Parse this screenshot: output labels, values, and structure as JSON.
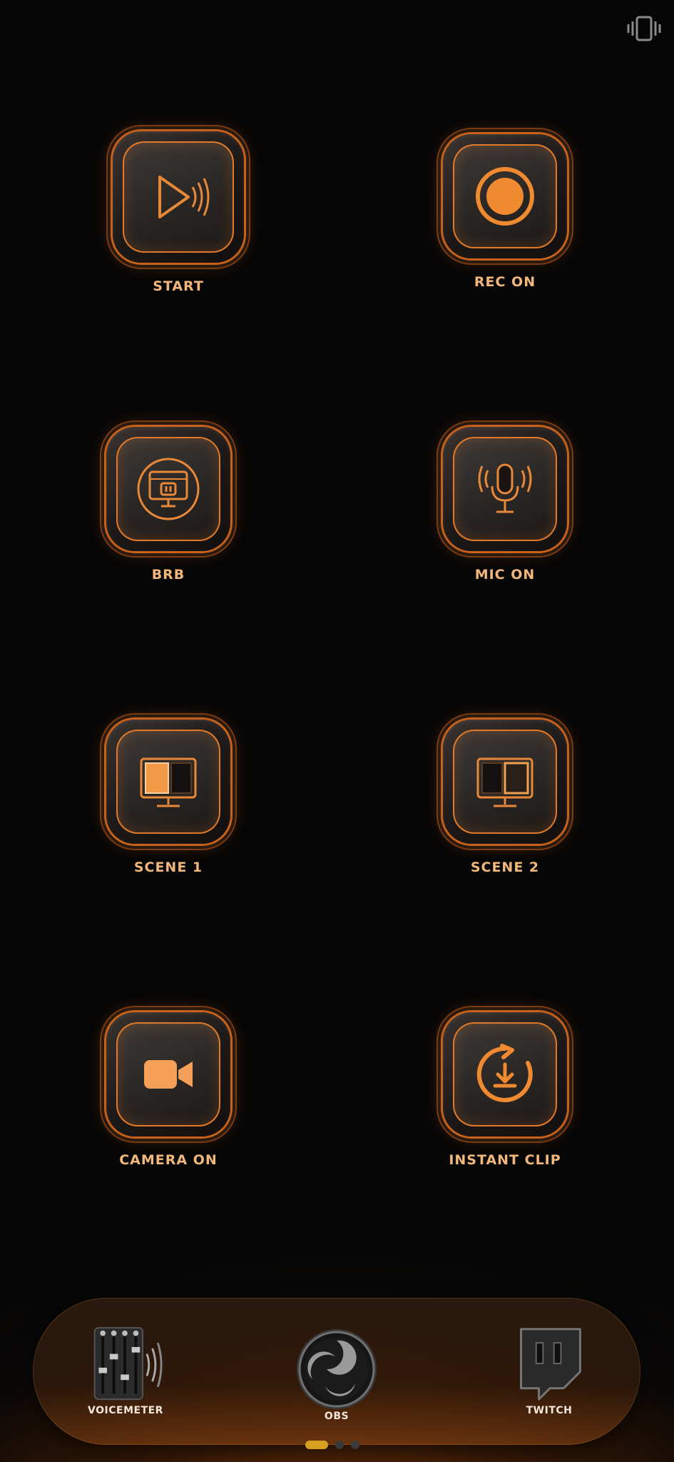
{
  "status": {
    "icon": "vibrate-icon"
  },
  "tiles": [
    {
      "label": "START",
      "icon": "play-broadcast-icon"
    },
    {
      "label": "REC ON",
      "icon": "record-icon"
    },
    {
      "label": "BRB",
      "icon": "pause-monitor-icon"
    },
    {
      "label": "MIC ON",
      "icon": "microphone-icon"
    },
    {
      "label": "SCENE 1",
      "icon": "scene-monitor-icon"
    },
    {
      "label": "SCENE 2",
      "icon": "scene-monitor-icon"
    },
    {
      "label": "CAMERA ON",
      "icon": "camera-icon"
    },
    {
      "label": "INSTANT CLIP",
      "icon": "clip-download-icon"
    }
  ],
  "dock": {
    "items": [
      {
        "label": "VOICEMETER",
        "icon": "mixer-icon"
      },
      {
        "label": "OBS",
        "icon": "obs-icon"
      },
      {
        "label": "TWITCH",
        "icon": "twitch-icon"
      }
    ]
  },
  "pager": {
    "pages": 3,
    "active": 1
  },
  "colors": {
    "accent": "#e07a2a",
    "label": "#f2b77a",
    "background": "#070707"
  }
}
